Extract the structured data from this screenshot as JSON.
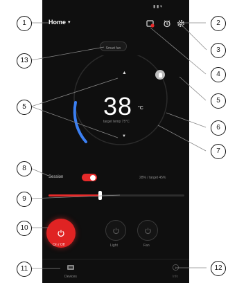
{
  "header": {
    "location": "Home",
    "location_caret": "▾",
    "status": "▮ ▮ ▾"
  },
  "top_icons": [
    "schedule-icon",
    "timer-icon",
    "settings-icon"
  ],
  "mode_pill": "Smart fan",
  "dial": {
    "temperature": "38",
    "unit": "°C",
    "caption": "target temp 75°C",
    "up_arrow": "▲",
    "down_arrow": "▼"
  },
  "session": {
    "label": "Session",
    "enabled": true,
    "readout": "28% / target 45%",
    "level": 0.38
  },
  "buttons": {
    "power": "On / Off",
    "light": "Light",
    "fan": "Fan"
  },
  "nav": {
    "devices": "Devices",
    "info": "Info"
  },
  "callouts": [
    "1",
    "2",
    "3",
    "4",
    "5",
    "5",
    "6",
    "7",
    "8",
    "9",
    "10",
    "11",
    "12",
    "13"
  ],
  "colors": {
    "accent": "#e62a2a",
    "background": "#0f0f0f",
    "dial_arc": "#3b7ff2"
  }
}
